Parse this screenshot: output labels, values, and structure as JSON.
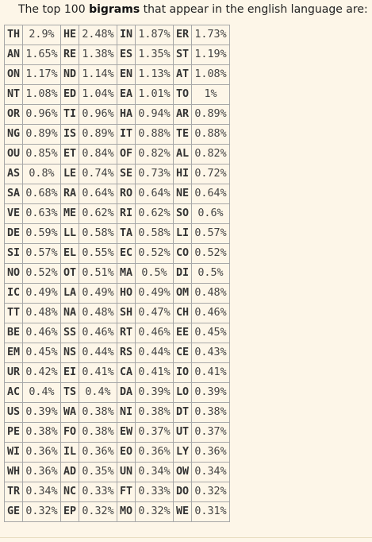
{
  "intro": {
    "before": "The top 100 ",
    "bold": "bigrams",
    "after": " that appear in the english language are:"
  },
  "rows": [
    [
      [
        "TH",
        "2.9%"
      ],
      [
        "HE",
        "2.48%"
      ],
      [
        "IN",
        "1.87%"
      ],
      [
        "ER",
        "1.73%"
      ]
    ],
    [
      [
        "AN",
        "1.65%"
      ],
      [
        "RE",
        "1.38%"
      ],
      [
        "ES",
        "1.35%"
      ],
      [
        "ST",
        "1.19%"
      ]
    ],
    [
      [
        "ON",
        "1.17%"
      ],
      [
        "ND",
        "1.14%"
      ],
      [
        "EN",
        "1.13%"
      ],
      [
        "AT",
        "1.08%"
      ]
    ],
    [
      [
        "NT",
        "1.08%"
      ],
      [
        "ED",
        "1.04%"
      ],
      [
        "EA",
        "1.01%"
      ],
      [
        "TO",
        "1%"
      ]
    ],
    [
      [
        "OR",
        "0.96%"
      ],
      [
        "TI",
        "0.96%"
      ],
      [
        "HA",
        "0.94%"
      ],
      [
        "AR",
        "0.89%"
      ]
    ],
    [
      [
        "NG",
        "0.89%"
      ],
      [
        "IS",
        "0.89%"
      ],
      [
        "IT",
        "0.88%"
      ],
      [
        "TE",
        "0.88%"
      ]
    ],
    [
      [
        "OU",
        "0.85%"
      ],
      [
        "ET",
        "0.84%"
      ],
      [
        "OF",
        "0.82%"
      ],
      [
        "AL",
        "0.82%"
      ]
    ],
    [
      [
        "AS",
        "0.8%"
      ],
      [
        "LE",
        "0.74%"
      ],
      [
        "SE",
        "0.73%"
      ],
      [
        "HI",
        "0.72%"
      ]
    ],
    [
      [
        "SA",
        "0.68%"
      ],
      [
        "RA",
        "0.64%"
      ],
      [
        "RO",
        "0.64%"
      ],
      [
        "NE",
        "0.64%"
      ]
    ],
    [
      [
        "VE",
        "0.63%"
      ],
      [
        "ME",
        "0.62%"
      ],
      [
        "RI",
        "0.62%"
      ],
      [
        "SO",
        "0.6%"
      ]
    ],
    [
      [
        "DE",
        "0.59%"
      ],
      [
        "LL",
        "0.58%"
      ],
      [
        "TA",
        "0.58%"
      ],
      [
        "LI",
        "0.57%"
      ]
    ],
    [
      [
        "SI",
        "0.57%"
      ],
      [
        "EL",
        "0.55%"
      ],
      [
        "EC",
        "0.52%"
      ],
      [
        "CO",
        "0.52%"
      ]
    ],
    [
      [
        "NO",
        "0.52%"
      ],
      [
        "OT",
        "0.51%"
      ],
      [
        "MA",
        "0.5%"
      ],
      [
        "DI",
        "0.5%"
      ]
    ],
    [
      [
        "IC",
        "0.49%"
      ],
      [
        "LA",
        "0.49%"
      ],
      [
        "HO",
        "0.49%"
      ],
      [
        "OM",
        "0.48%"
      ]
    ],
    [
      [
        "TT",
        "0.48%"
      ],
      [
        "NA",
        "0.48%"
      ],
      [
        "SH",
        "0.47%"
      ],
      [
        "CH",
        "0.46%"
      ]
    ],
    [
      [
        "BE",
        "0.46%"
      ],
      [
        "SS",
        "0.46%"
      ],
      [
        "RT",
        "0.46%"
      ],
      [
        "EE",
        "0.45%"
      ]
    ],
    [
      [
        "EM",
        "0.45%"
      ],
      [
        "NS",
        "0.44%"
      ],
      [
        "RS",
        "0.44%"
      ],
      [
        "CE",
        "0.43%"
      ]
    ],
    [
      [
        "UR",
        "0.42%"
      ],
      [
        "EI",
        "0.41%"
      ],
      [
        "CA",
        "0.41%"
      ],
      [
        "IO",
        "0.41%"
      ]
    ],
    [
      [
        "AC",
        "0.4%"
      ],
      [
        "TS",
        "0.4%"
      ],
      [
        "DA",
        "0.39%"
      ],
      [
        "LO",
        "0.39%"
      ]
    ],
    [
      [
        "US",
        "0.39%"
      ],
      [
        "WA",
        "0.38%"
      ],
      [
        "NI",
        "0.38%"
      ],
      [
        "DT",
        "0.38%"
      ]
    ],
    [
      [
        "PE",
        "0.38%"
      ],
      [
        "FO",
        "0.38%"
      ],
      [
        "EW",
        "0.37%"
      ],
      [
        "UT",
        "0.37%"
      ]
    ],
    [
      [
        "WI",
        "0.36%"
      ],
      [
        "IL",
        "0.36%"
      ],
      [
        "EO",
        "0.36%"
      ],
      [
        "LY",
        "0.36%"
      ]
    ],
    [
      [
        "WH",
        "0.36%"
      ],
      [
        "AD",
        "0.35%"
      ],
      [
        "UN",
        "0.34%"
      ],
      [
        "OW",
        "0.34%"
      ]
    ],
    [
      [
        "TR",
        "0.34%"
      ],
      [
        "NC",
        "0.33%"
      ],
      [
        "FT",
        "0.33%"
      ],
      [
        "DO",
        "0.32%"
      ]
    ],
    [
      [
        "GE",
        "0.32%"
      ],
      [
        "EP",
        "0.32%"
      ],
      [
        "MO",
        "0.32%"
      ],
      [
        "WE",
        "0.31%"
      ]
    ]
  ]
}
